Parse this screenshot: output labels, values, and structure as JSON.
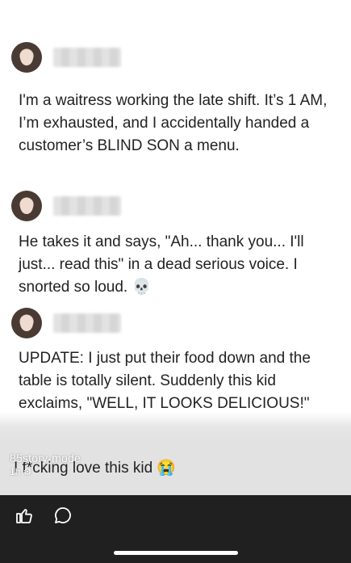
{
  "posts": [
    {
      "text": "I'm a waitress working the late shift. It’s 1 AM, I’m exhausted, and I accidentally handed a customer’s BLIND SON a menu."
    },
    {
      "text": "He takes it and says, \"Ah... thank you... I'll just... read this\" in a dead serious voice. I snorted so loud. 💀"
    },
    {
      "text": "UPDATE: I just put their food down and the table is totally silent. Suddenly this kid exclaims, \"WELL, IT LOOKS DELICIOUS!\""
    }
  ],
  "final_line": "I f*cking love this kid 😭",
  "watermark": {
    "label": "85story-mode",
    "sub": "1h ⚙"
  },
  "actions": {
    "like_icon": "thumbs-up-icon",
    "comment_icon": "comment-bubble-icon"
  },
  "colors": {
    "action_bar": "#202020",
    "text": "#222222"
  }
}
